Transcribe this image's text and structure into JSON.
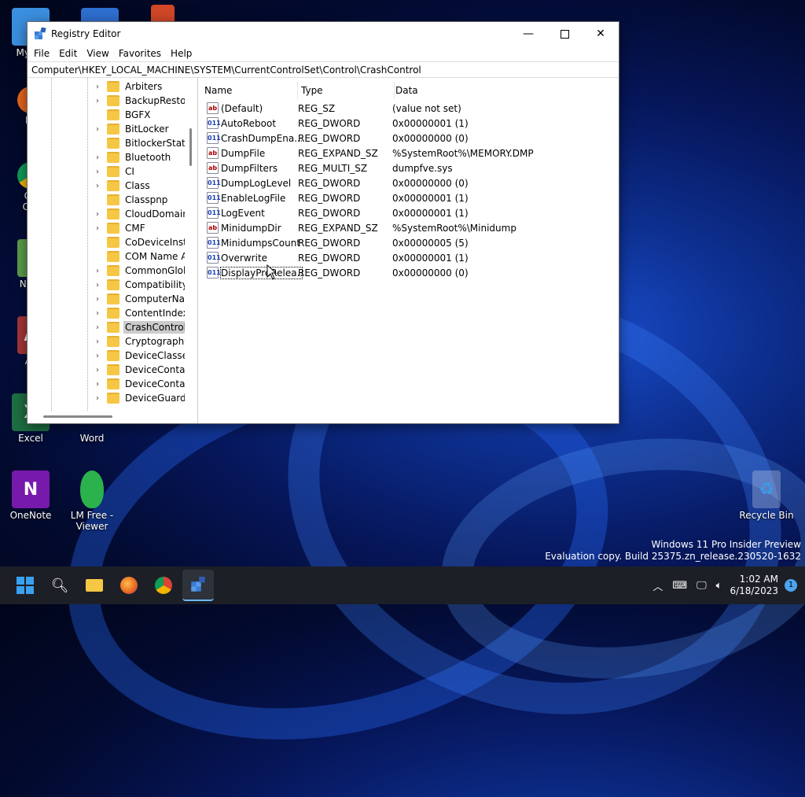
{
  "desktop": {
    "icons": [
      {
        "label": "My Co",
        "icon": "this-pc-icon"
      },
      {
        "label": "Fir",
        "icon": "firefox-icon"
      },
      {
        "label": "Go",
        "sub": "Chr",
        "icon": "chrome-icon"
      },
      {
        "label": "Note",
        "icon": "notepad-icon"
      },
      {
        "label": "Ac",
        "icon": "access-icon"
      },
      {
        "label": "Excel",
        "icon": "excel-icon"
      },
      {
        "label": "Word",
        "icon": "word-icon"
      },
      {
        "label": "OneNote",
        "icon": "onenote-icon"
      },
      {
        "label": "LM Free -",
        "sub": "Viewer",
        "icon": "lm-viewer-icon"
      },
      {
        "label": "Recycle Bin",
        "icon": "recycle-bin-icon"
      }
    ],
    "watermark_line1": "Windows 11 Pro Insider Preview",
    "watermark_line2": "Evaluation copy. Build 25375.zn_release.230520-1632"
  },
  "window": {
    "title": "Registry Editor",
    "menu": [
      "File",
      "Edit",
      "View",
      "Favorites",
      "Help"
    ],
    "address": "Computer\\HKEY_LOCAL_MACHINE\\SYSTEM\\CurrentControlSet\\Control\\CrashControl",
    "tree": [
      {
        "label": "Arbiters",
        "expandable": true
      },
      {
        "label": "BackupRestore",
        "expandable": true
      },
      {
        "label": "BGFX",
        "expandable": false
      },
      {
        "label": "BitLocker",
        "expandable": true
      },
      {
        "label": "BitlockerStatus",
        "expandable": false
      },
      {
        "label": "Bluetooth",
        "expandable": true
      },
      {
        "label": "CI",
        "expandable": true
      },
      {
        "label": "Class",
        "expandable": true
      },
      {
        "label": "Classpnp",
        "expandable": false
      },
      {
        "label": "CloudDomainJ",
        "expandable": true
      },
      {
        "label": "CMF",
        "expandable": true
      },
      {
        "label": "CoDeviceInsta",
        "expandable": false
      },
      {
        "label": "COM Name A",
        "expandable": false
      },
      {
        "label": "CommonGlob",
        "expandable": true
      },
      {
        "label": "Compatibility",
        "expandable": true
      },
      {
        "label": "ComputerNam",
        "expandable": true
      },
      {
        "label": "ContentIndex",
        "expandable": true
      },
      {
        "label": "CrashControl",
        "expandable": true,
        "selected": true
      },
      {
        "label": "Cryptography",
        "expandable": true
      },
      {
        "label": "DeviceClasses",
        "expandable": true
      },
      {
        "label": "DeviceContair",
        "expandable": true
      },
      {
        "label": "DeviceContair",
        "expandable": true
      },
      {
        "label": "DeviceGuard",
        "expandable": true
      }
    ],
    "columns": {
      "name": "Name",
      "type": "Type",
      "data": "Data"
    },
    "values": [
      {
        "name": "(Default)",
        "type": "REG_SZ",
        "data": "(value not set)",
        "kind": "sz"
      },
      {
        "name": "AutoReboot",
        "type": "REG_DWORD",
        "data": "0x00000001 (1)",
        "kind": "dw"
      },
      {
        "name": "CrashDumpEna...",
        "type": "REG_DWORD",
        "data": "0x00000000 (0)",
        "kind": "dw"
      },
      {
        "name": "DumpFile",
        "type": "REG_EXPAND_SZ",
        "data": "%SystemRoot%\\MEMORY.DMP",
        "kind": "sz"
      },
      {
        "name": "DumpFilters",
        "type": "REG_MULTI_SZ",
        "data": "dumpfve.sys",
        "kind": "sz"
      },
      {
        "name": "DumpLogLevel",
        "type": "REG_DWORD",
        "data": "0x00000000 (0)",
        "kind": "dw"
      },
      {
        "name": "EnableLogFile",
        "type": "REG_DWORD",
        "data": "0x00000001 (1)",
        "kind": "dw"
      },
      {
        "name": "LogEvent",
        "type": "REG_DWORD",
        "data": "0x00000001 (1)",
        "kind": "dw"
      },
      {
        "name": "MinidumpDir",
        "type": "REG_EXPAND_SZ",
        "data": "%SystemRoot%\\Minidump",
        "kind": "sz"
      },
      {
        "name": "MinidumpsCount",
        "type": "REG_DWORD",
        "data": "0x00000005 (5)",
        "kind": "dw"
      },
      {
        "name": "Overwrite",
        "type": "REG_DWORD",
        "data": "0x00000001 (1)",
        "kind": "dw"
      },
      {
        "name": "DisplayPreRelea...",
        "type": "REG_DWORD",
        "data": "0x00000000 (0)",
        "kind": "dw",
        "focused": true
      }
    ],
    "icon_glyphs": {
      "sz": "ab",
      "dw": "011"
    }
  },
  "taskbar": {
    "items": [
      "start-icon",
      "search-icon",
      "file-explorer-icon",
      "firefox-icon",
      "chrome-icon",
      "registry-editor-icon"
    ],
    "time": "1:02 AM",
    "date": "6/18/2023",
    "notification_count": "1"
  }
}
